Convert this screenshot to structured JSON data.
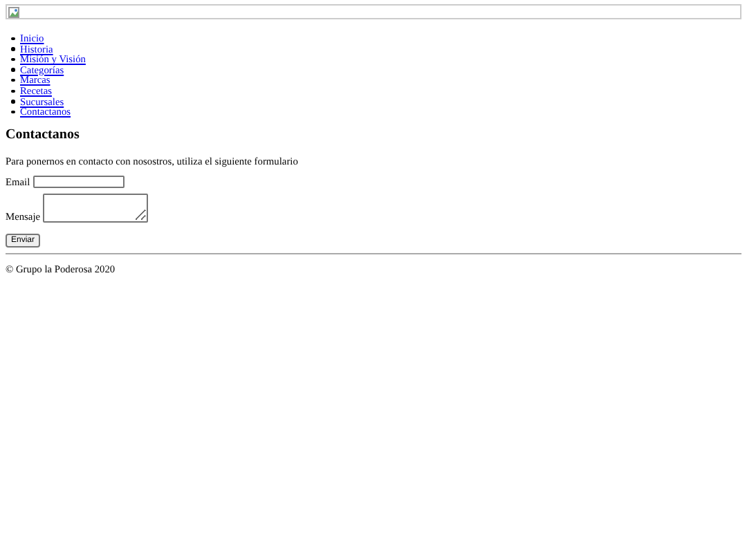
{
  "nav": [
    "Inicio",
    "Historia",
    "Misión y Visión",
    "Categorías",
    "Marcas",
    "Recetas",
    "Sucursales",
    "Contactanos"
  ],
  "heading": "Contactanos",
  "intro": "Para ponernos en contacto con nosostros, utiliza el siguiente formulario",
  "form": {
    "email_label": "Email",
    "message_label": "Mensaje",
    "submit": "Enviar"
  },
  "footer": "© Grupo la Poderosa 2020"
}
